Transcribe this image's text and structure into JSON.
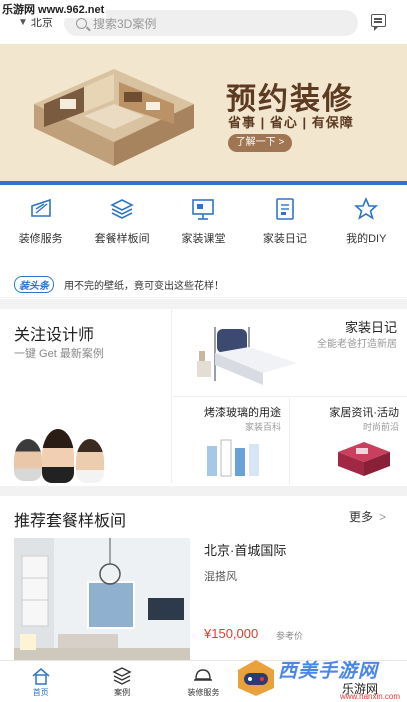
{
  "watermark_top": "乐游网 www.962.net",
  "header": {
    "location": "北京",
    "search_placeholder": "搜索3D案例"
  },
  "banner": {
    "title": "预约装修",
    "subtitle": "省事 | 省心 | 有保障",
    "button": "了解一下 >"
  },
  "quick_nav": [
    {
      "label": "装修服务",
      "icon": "decor-service-icon"
    },
    {
      "label": "套餐样板间",
      "icon": "layers-icon"
    },
    {
      "label": "家装课堂",
      "icon": "classroom-icon"
    },
    {
      "label": "家装日记",
      "icon": "diary-icon"
    },
    {
      "label": "我的DIY",
      "icon": "star-diy-icon"
    }
  ],
  "news": {
    "tag": "装头条",
    "text": "用不完的壁纸，竟可变出这些花样！"
  },
  "designer": {
    "title": "关注设计师",
    "subtitle": "一键 Get 最新案例"
  },
  "diary": {
    "title": "家装日记",
    "subtitle": "全能老爸打造新居"
  },
  "cards": [
    {
      "title": "烤漆玻璃的用途",
      "subtitle": "家装百科"
    },
    {
      "title": "家居资讯·活动",
      "subtitle": "时尚前沿"
    }
  ],
  "recommend": {
    "title": "推荐套餐样板间",
    "more": "更多",
    "name": "北京·首城国际",
    "style": "混搭风",
    "price": "¥150,000",
    "price_note": "参考价"
  },
  "tabs": [
    {
      "label": "首页",
      "icon": "home-icon"
    },
    {
      "label": "案例",
      "icon": "cube-icon"
    },
    {
      "label": "装修服务",
      "icon": "helmet-icon"
    },
    {
      "label": "",
      "icon": ""
    },
    {
      "label": "",
      "icon": ""
    }
  ],
  "watermark_bottom": {
    "brand": "西美手游网",
    "sub": "乐游网",
    "url": "www.hanxin.com"
  },
  "colors": {
    "accent": "#2f74c8",
    "price": "#e23b2f",
    "banner_bg": "#f3e6cf",
    "banner_text": "#5c3b22"
  }
}
